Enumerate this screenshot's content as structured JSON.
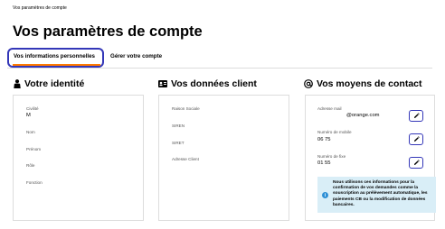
{
  "breadcrumb": "Vos paramètres de compte",
  "page_title": "Vos paramètres de compte",
  "tabs": [
    {
      "label": "Vos informations personnelles",
      "active": true
    },
    {
      "label": "Gérer votre compte",
      "active": false
    }
  ],
  "accent_color": "#ff7900",
  "highlight_color": "#3437b8",
  "identity": {
    "title": "Votre identité",
    "icon": "person-icon",
    "fields": [
      {
        "label": "Civilité",
        "value": "M"
      },
      {
        "label": "Nom",
        "value": ""
      },
      {
        "label": "Prénom",
        "value": ""
      },
      {
        "label": "Rôle",
        "value": ""
      },
      {
        "label": "Fonction",
        "value": ""
      }
    ]
  },
  "client_data": {
    "title": "Vos données client",
    "icon": "id-card-icon",
    "fields": [
      {
        "label": "Raison Sociale",
        "value": ""
      },
      {
        "label": "SIREN",
        "value": ""
      },
      {
        "label": "SIRET",
        "value": ""
      },
      {
        "label": "Adresse Client",
        "value": ""
      }
    ]
  },
  "contact": {
    "title": "Vos moyens de contact",
    "icon": "at-sign-icon",
    "fields": [
      {
        "label": "Adresse mail",
        "value": "@orange.com"
      },
      {
        "label": "Numéro de mobile",
        "value": "06 75"
      },
      {
        "label": "Numéro de fixe",
        "value": "01 55"
      }
    ],
    "info_text": "Nous utilisons ces informations pour la confirmation de vos demandes comme la souscription au prélèvement automatique, les paiements CB ou la modification de données bancaires.",
    "info_icon": "i"
  }
}
